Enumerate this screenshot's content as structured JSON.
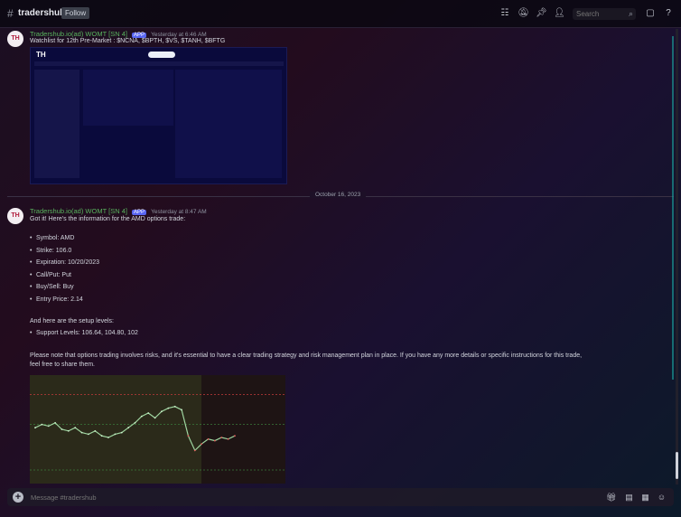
{
  "app": {
    "channel": "tradershub",
    "tag": "Follow"
  },
  "search": {
    "placeholder": "Search"
  },
  "message1": {
    "avatar": "TH",
    "author": "Tradershub.io(ad) WOMT [SN 4]",
    "app_badge": "APP",
    "timestamp": "Yesterday at 6:46 AM",
    "text": "Watchlist for 12th Pre-Market : $NCNA, $BPTH, $VS, $TANH, $BFTG",
    "dashboard_logo": "TH"
  },
  "divider": {
    "label": "October 16, 2023"
  },
  "message2": {
    "avatar": "TH",
    "author": "Tradershub.io(ad) WOMT [SN 4]",
    "app_badge": "APP",
    "timestamp": "Yesterday at 8:47 AM",
    "intro": "Got it! Here's the information for the AMD options trade:",
    "options": [
      "Symbol: AMD",
      "Strike: 106.0",
      "Expiration: 10/20/2023",
      "Call/Put: Put",
      "Buy/Sell: Buy",
      "Entry Price: 2.14"
    ],
    "setup_intro": "And here are the setup levels:",
    "setup": [
      "Support Levels: 106.64, 104.80, 102"
    ],
    "note_line1": "Please note that options trading involves risks, and it's essential to have a clear trading strategy and risk management plan in place. If you have any more details or specific instructions for this trade,",
    "note_line2": "feel free to share them."
  },
  "input": {
    "placeholder": "Message #tradershub"
  },
  "colors": {
    "author": "#59b35e",
    "accent": "#5865f2",
    "brand": "#b01c3c"
  },
  "chart_data": {
    "type": "line",
    "x": [
      0,
      1,
      2,
      3,
      4,
      5,
      6,
      7,
      8,
      9,
      10,
      11,
      12,
      13,
      14,
      15,
      16,
      17,
      18,
      19,
      20,
      21,
      22,
      23,
      24,
      25,
      26,
      27,
      28,
      29,
      30
    ],
    "series": [
      {
        "values": [
          104.6,
          104.8,
          104.7,
          104.9,
          104.5,
          104.4,
          104.6,
          104.3,
          104.2,
          104.4,
          104.1,
          104.0,
          104.2,
          104.3,
          104.6,
          104.9,
          105.3,
          105.5,
          105.2,
          105.6,
          105.8,
          105.9,
          105.7,
          104.1,
          103.2,
          103.6,
          103.9,
          103.8,
          104.0,
          103.9,
          104.1
        ]
      }
    ],
    "levels": [
      106.64,
      104.8,
      102
    ],
    "ylim": [
      101.5,
      107.5
    ]
  }
}
